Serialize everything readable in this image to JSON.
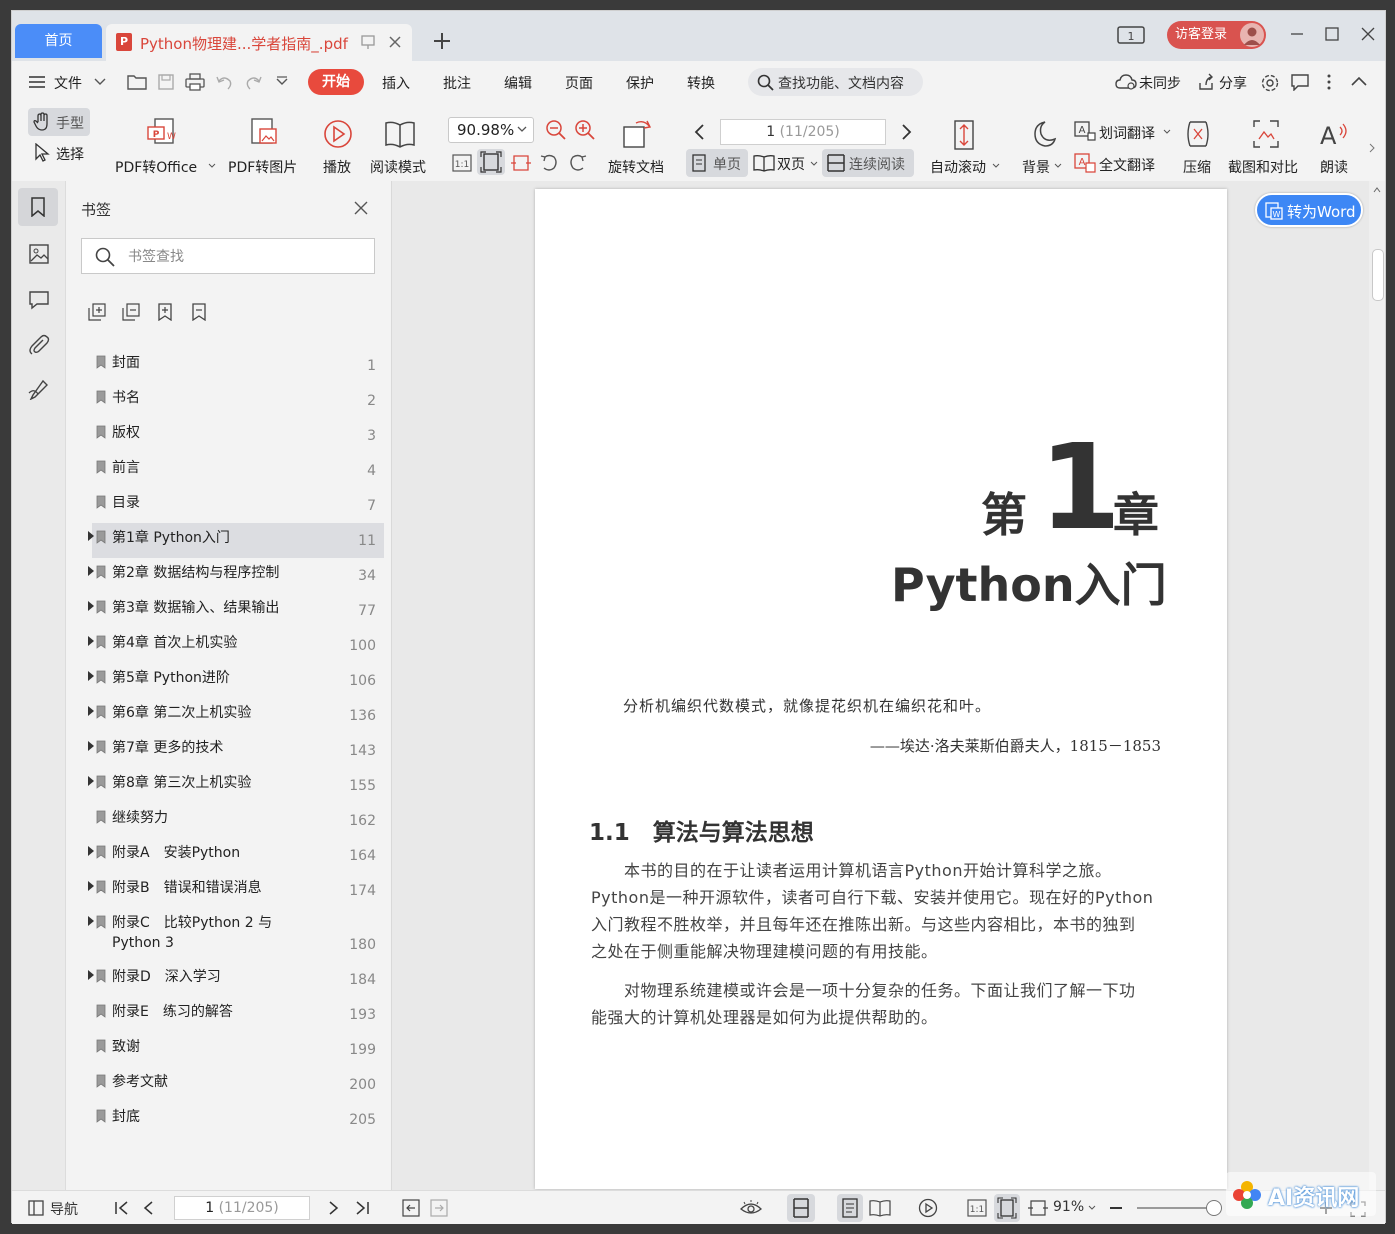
{
  "titlebar": {
    "home_tab": "首页",
    "doc_tab": "Python物理建...学者指南_.pdf",
    "guest_login": "访客登录"
  },
  "menubar": {
    "file": "文件",
    "items": [
      "开始",
      "插入",
      "批注",
      "编辑",
      "页面",
      "保护",
      "转换"
    ],
    "search": "查找功能、文档内容",
    "sync": "未同步",
    "share": "分享"
  },
  "toolbar": {
    "hand": "手型",
    "select": "选择",
    "pdf_to_office": "PDF转Office",
    "pdf_to_image": "PDF转图片",
    "play": "播放",
    "read_mode": "阅读模式",
    "zoom": "90.98%",
    "rotate_doc": "旋转文档",
    "page_current": "1",
    "page_total": "(11/205)",
    "single_page": "单页",
    "double_page": "双页",
    "continuous": "连续阅读",
    "auto_scroll": "自动滚动",
    "background": "背景",
    "word_translate": "划词翻译",
    "full_translate": "全文翻译",
    "compress": "压缩",
    "screenshot_compare": "截图和对比",
    "read_aloud": "朗读"
  },
  "bookmarks": {
    "title": "书签",
    "search_placeholder": "书签查找",
    "items": [
      {
        "label": "封面",
        "page": "1"
      },
      {
        "label": "书名",
        "page": "2"
      },
      {
        "label": "版权",
        "page": "3"
      },
      {
        "label": "前言",
        "page": "4"
      },
      {
        "label": "目录",
        "page": "7"
      },
      {
        "label": "第1章 Python入门",
        "page": "11"
      },
      {
        "label": "第2章 数据结构与程序控制",
        "page": "34"
      },
      {
        "label": "第3章 数据输入、结果输出",
        "page": "77"
      },
      {
        "label": "第4章 首次上机实验",
        "page": "100"
      },
      {
        "label": "第5章 Python进阶",
        "page": "106"
      },
      {
        "label": "第6章 第二次上机实验",
        "page": "136"
      },
      {
        "label": "第7章 更多的技术",
        "page": "143"
      },
      {
        "label": "第8章 第三次上机实验",
        "page": "155"
      },
      {
        "label": "继续努力",
        "page": "162"
      },
      {
        "label": "附录A　安装Python",
        "page": "164"
      },
      {
        "label": "附录B　错误和错误消息",
        "page": "174"
      },
      {
        "label": "附录C　比较Python 2 与Python 3",
        "page": "180"
      },
      {
        "label": "附录D　深入学习",
        "page": "184"
      },
      {
        "label": "附录E　练习的解答",
        "page": "193"
      },
      {
        "label": "致谢",
        "page": "199"
      },
      {
        "label": "参考文献",
        "page": "200"
      },
      {
        "label": "封底",
        "page": "205"
      }
    ]
  },
  "document": {
    "chapter_prefix": "第",
    "chapter_number": "1",
    "chapter_suffix": "章",
    "chapter_title": "Python入门",
    "epigraph": "分析机编织代数模式，就像提花织机在编织花和叶。",
    "epigraph_attribution": "——埃达·洛夫莱斯伯爵夫人，1815－1853",
    "section_title": "1.1　算法与算法思想",
    "para1_lines": [
      "　　本书的目的在于让读者运用计算机语言Python开始计算科学之旅。",
      "Python是一种开源软件，读者可自行下载、安装并使用它。现在好的Python",
      "入门教程不胜枚举，并且每年还在推陈出新。与这些内容相比，本书的独到",
      "之处在于侧重能解决物理建模问题的有用技能。"
    ],
    "para2_lines": [
      "　　对物理系统建模或许会是一项十分复杂的任务。下面让我们了解一下功",
      "能强大的计算机处理器是如何为此提供帮助的。"
    ],
    "convert_to_word": "转为Word"
  },
  "statusbar": {
    "nav": "导航",
    "page_current": "1",
    "page_total": "(11/205)",
    "zoom": "91%"
  },
  "watermark": "AI资讯网"
}
